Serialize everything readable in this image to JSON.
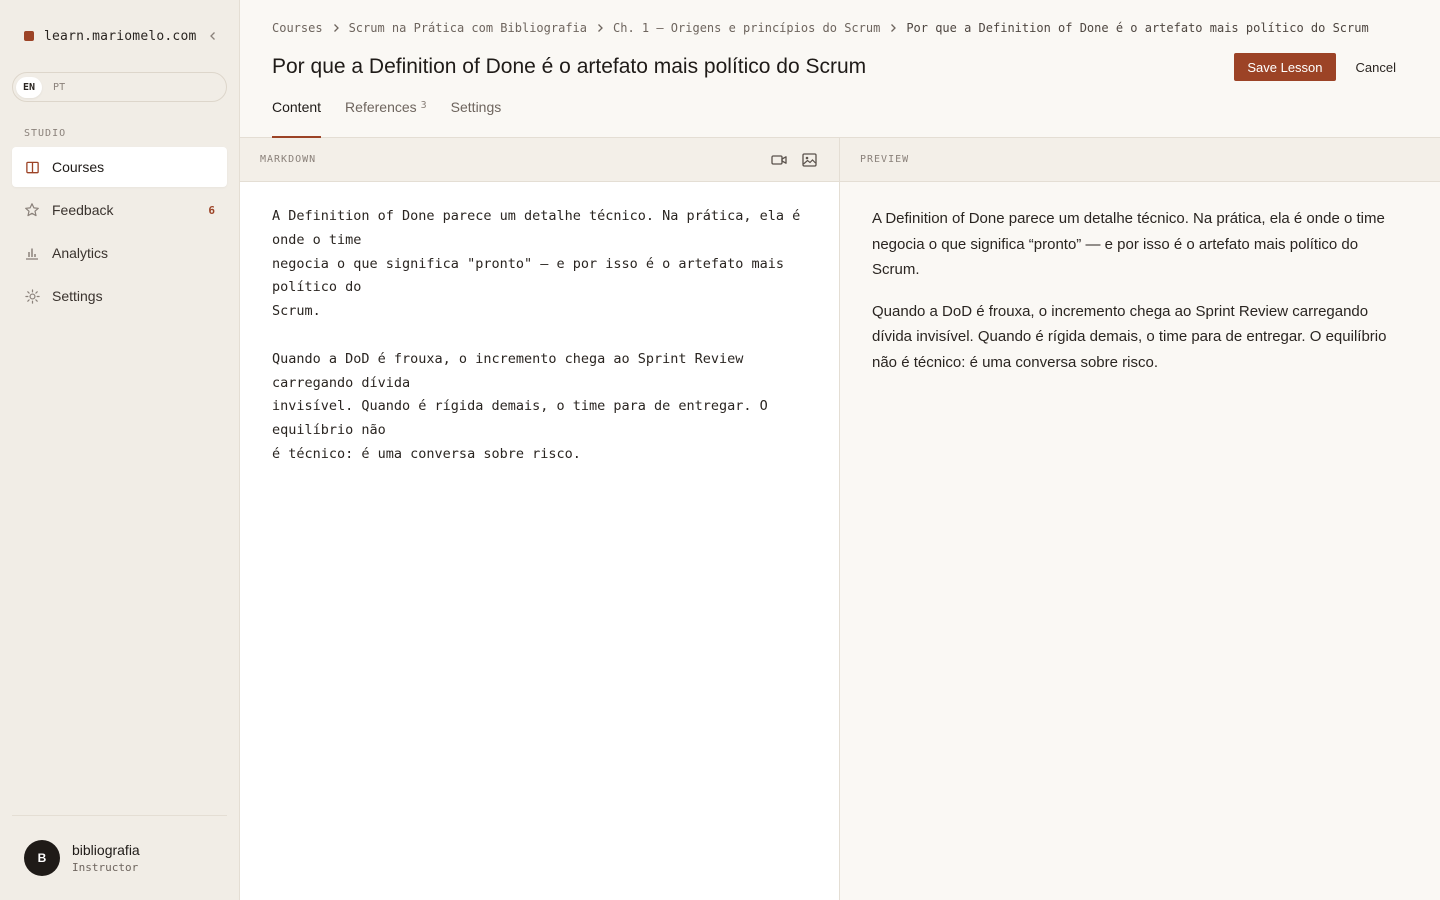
{
  "brand": {
    "name": "learn.mariomelo.com"
  },
  "lang": {
    "options": [
      "EN",
      "PT"
    ],
    "active": "EN"
  },
  "sidebar": {
    "section_label": "STUDIO",
    "items": [
      {
        "label": "Courses",
        "icon": "book-icon",
        "active": true
      },
      {
        "label": "Feedback",
        "icon": "star-icon",
        "badge": "6"
      },
      {
        "label": "Analytics",
        "icon": "bar-chart-icon"
      },
      {
        "label": "Settings",
        "icon": "gear-icon"
      }
    ]
  },
  "user": {
    "initial": "B",
    "name": "bibliografia",
    "role": "Instructor"
  },
  "breadcrumb": [
    "Courses",
    "Scrum na Prática com Bibliografia",
    "Ch. 1 — Origens e princípios do Scrum",
    "Por que a Definition of Done é o artefato mais político do Scrum"
  ],
  "page": {
    "title": "Por que a Definition of Done é o artefato mais político do Scrum",
    "save_label": "Save Lesson",
    "cancel_label": "Cancel"
  },
  "tabs": [
    {
      "label": "Content",
      "active": true
    },
    {
      "label": "References",
      "count": "3"
    },
    {
      "label": "Settings"
    }
  ],
  "editor": {
    "label": "MARKDOWN",
    "content": "A Definition of Done parece um detalhe técnico. Na prática, ela é onde o time\nnegocia o que significa \"pronto\" — e por isso é o artefato mais político do\nScrum.\n\nQuando a DoD é frouxa, o incremento chega ao Sprint Review carregando dívida\ninvisível. Quando é rígida demais, o time para de entregar. O equilíbrio não\né técnico: é uma conversa sobre risco."
  },
  "preview": {
    "label": "PREVIEW",
    "paragraphs": [
      "A Definition of Done parece um detalhe técnico. Na prática, ela é onde o time negocia o que significa “pronto” — e por isso é o artefato mais político do Scrum.",
      "Quando a DoD é frouxa, o incremento chega ao Sprint Review carregando dívida invisível. Quando é rígida demais, o time para de entregar. O equilíbrio não é técnico: é uma conversa sobre risco."
    ]
  },
  "colors": {
    "accent": "#9c4326",
    "sidebar_bg": "#f1ede6",
    "page_bg": "#faf8f4"
  }
}
